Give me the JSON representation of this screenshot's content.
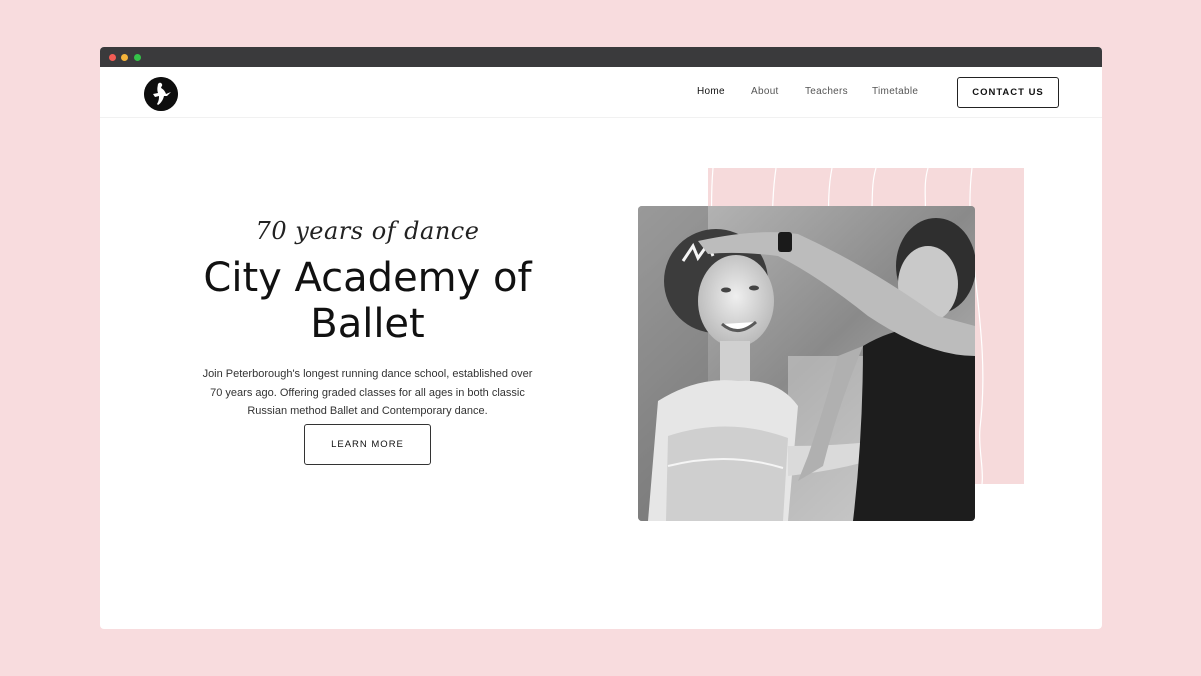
{
  "nav": {
    "logo_icon": "ballerina-logo-icon",
    "items": [
      {
        "label": "Home",
        "active": true
      },
      {
        "label": "About",
        "active": false
      },
      {
        "label": "Teachers",
        "active": false
      },
      {
        "label": "Timetable",
        "active": false
      }
    ],
    "contact_label": "CONTACT US"
  },
  "hero": {
    "tagline": "70 years of dance",
    "title_line1": "City Academy of",
    "title_line2": "Ballet",
    "description": "Join Peterborough's longest running dance school, established over 70 years ago. Offering graded classes for all ages in both classic Russian method Ballet and Contemporary dance.",
    "cta_label": "LEARN MORE",
    "image_icon": "ballet-teacher-student-photo"
  },
  "colors": {
    "background": "#f8dcde",
    "accent_pink": "#f6dadb",
    "window_bar": "#3a3a3c",
    "dot_red": "#f25c55",
    "dot_yellow": "#f5b43a",
    "dot_green": "#34c349"
  }
}
